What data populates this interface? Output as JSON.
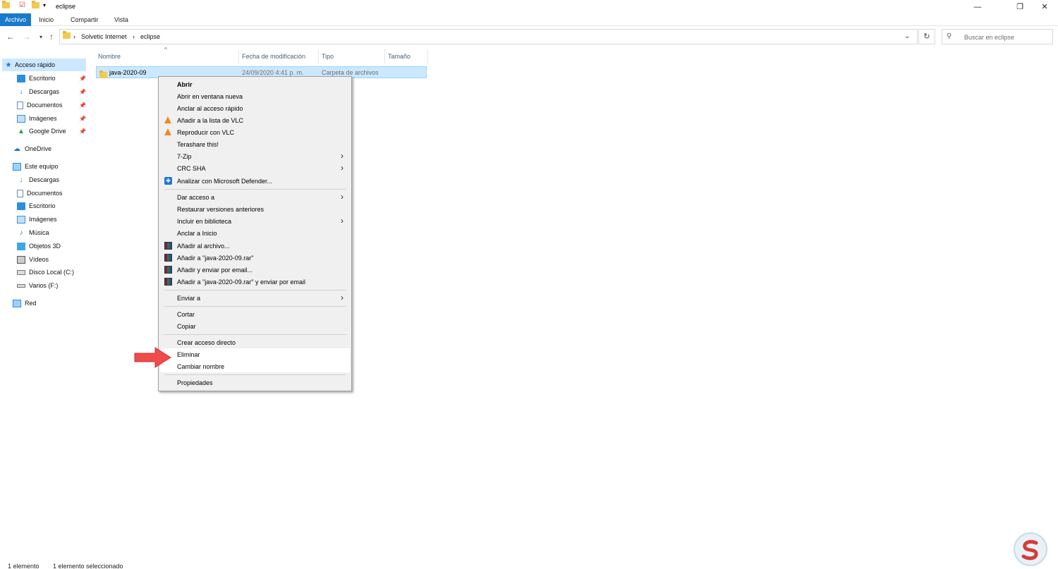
{
  "window": {
    "title": "eclipse",
    "minimize_glyph": "—",
    "restore_glyph": "❐",
    "close_glyph": "✕"
  },
  "ribbon": {
    "tabs": [
      "Archivo",
      "Inicio",
      "Compartir",
      "Vista"
    ]
  },
  "address": {
    "segments": [
      "Solvetic Internet",
      "eclipse"
    ],
    "separator": "›"
  },
  "search": {
    "placeholder": "Buscar en eclipse"
  },
  "sidebar": {
    "quick_access": "Acceso rápido",
    "quick_items": [
      "Escritorio",
      "Descargas",
      "Documentos",
      "Imágenes",
      "Google Drive"
    ],
    "onedrive": "OneDrive",
    "this_pc": "Este equipo",
    "pc_items": [
      "Descargas",
      "Documentos",
      "Escritorio",
      "Imágenes",
      "Música",
      "Objetos 3D",
      "Vídeos",
      "Disco Local (C:)",
      "Varios (F:)"
    ],
    "network": "Red"
  },
  "columns": [
    "Nombre",
    "Fecha de modificación",
    "Tipo",
    "Tamaño"
  ],
  "file": {
    "name": "java-2020-09",
    "date": "24/09/2020 4:41 p. m.",
    "type": "Carpeta de archivos"
  },
  "context_menu": {
    "items": [
      "Abrir",
      "Abrir en ventana nueva",
      "Anclar al acceso rápido",
      "Añadir a la lista de VLC",
      "Reproducir con VLC",
      "Terashare this!",
      "7-Zip",
      "CRC SHA",
      "Analizar con Microsoft Defender...",
      "Dar acceso a",
      "Restaurar versiones anteriores",
      "Incluir en biblioteca",
      "Anclar a Inicio",
      "Añadir al archivo...",
      "Añadir a \"java-2020-09.rar\"",
      "Añadir y enviar por email...",
      "Añadir a \"java-2020-09.rar\" y enviar por email",
      "Enviar a",
      "Cortar",
      "Copiar",
      "Crear acceso directo",
      "Eliminar",
      "Cambiar nombre",
      "Propiedades"
    ]
  },
  "status": {
    "count": "1 elemento",
    "selected": "1 elemento seleccionado"
  },
  "colors": {
    "accent": "#1979ca",
    "selection": "#cce8ff",
    "arrow": "#f04b4b"
  }
}
